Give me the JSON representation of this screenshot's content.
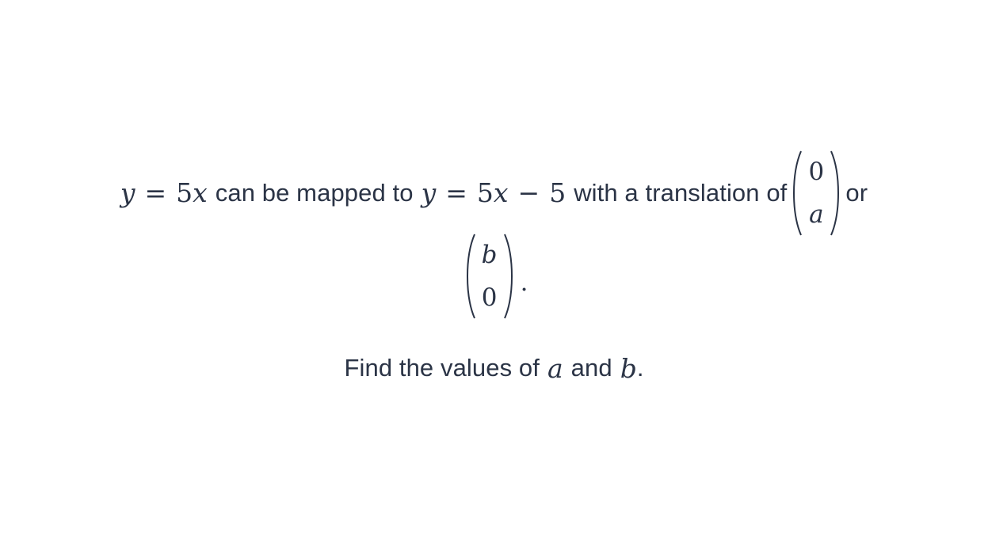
{
  "question": {
    "line1": {
      "eq1": {
        "lhs": "y",
        "op": "=",
        "coef": "5",
        "var": "x"
      },
      "text1": "can be mapped to",
      "eq2": {
        "lhs": "y",
        "op": "=",
        "coef": "5",
        "var": "x",
        "minus": "−",
        "const": "5"
      },
      "text2": "with a translation of",
      "vector1": {
        "top": "0",
        "bottom": "a"
      },
      "text3": "or"
    },
    "line2": {
      "vector2": {
        "top": "b",
        "bottom": "0"
      },
      "period": "."
    },
    "line3": {
      "prefix": "Find the values of",
      "var_a": "a",
      "conj": "and",
      "var_b": "b",
      "end": "."
    }
  }
}
